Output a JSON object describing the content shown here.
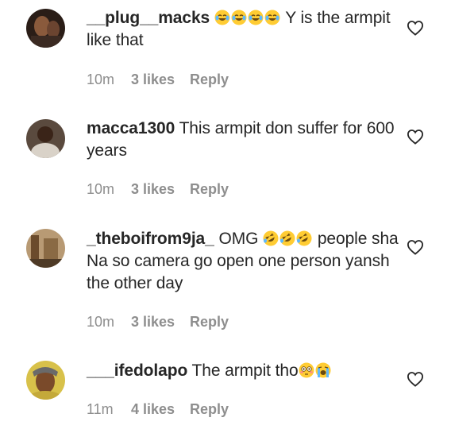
{
  "comments": [
    {
      "username": "__plug__macks",
      "emojis": [
        "joy-emoji",
        "joy-emoji",
        "joy-emoji",
        "joy-emoji"
      ],
      "text": "Y is the armpit like that",
      "time": "10m",
      "likes": "3 likes",
      "reply": "Reply"
    },
    {
      "username": "macca1300",
      "text": "This armpit don suffer for 600 years",
      "time": "10m",
      "likes": "3 likes",
      "reply": "Reply"
    },
    {
      "username": "_theboifrom9ja_",
      "text_before": "OMG",
      "emojis": [
        "rofl-emoji",
        "rofl-emoji",
        "rofl-emoji"
      ],
      "text": "people sha Na so camera go open one person yansh the other day",
      "time": "10m",
      "likes": "3 likes",
      "reply": "Reply"
    },
    {
      "username": "___ifedolapo",
      "text": "The armpit tho",
      "emojis": [
        "flushed-emoji",
        "crying-emoji"
      ],
      "time": "11m",
      "likes": "4 likes",
      "reply": "Reply"
    }
  ]
}
